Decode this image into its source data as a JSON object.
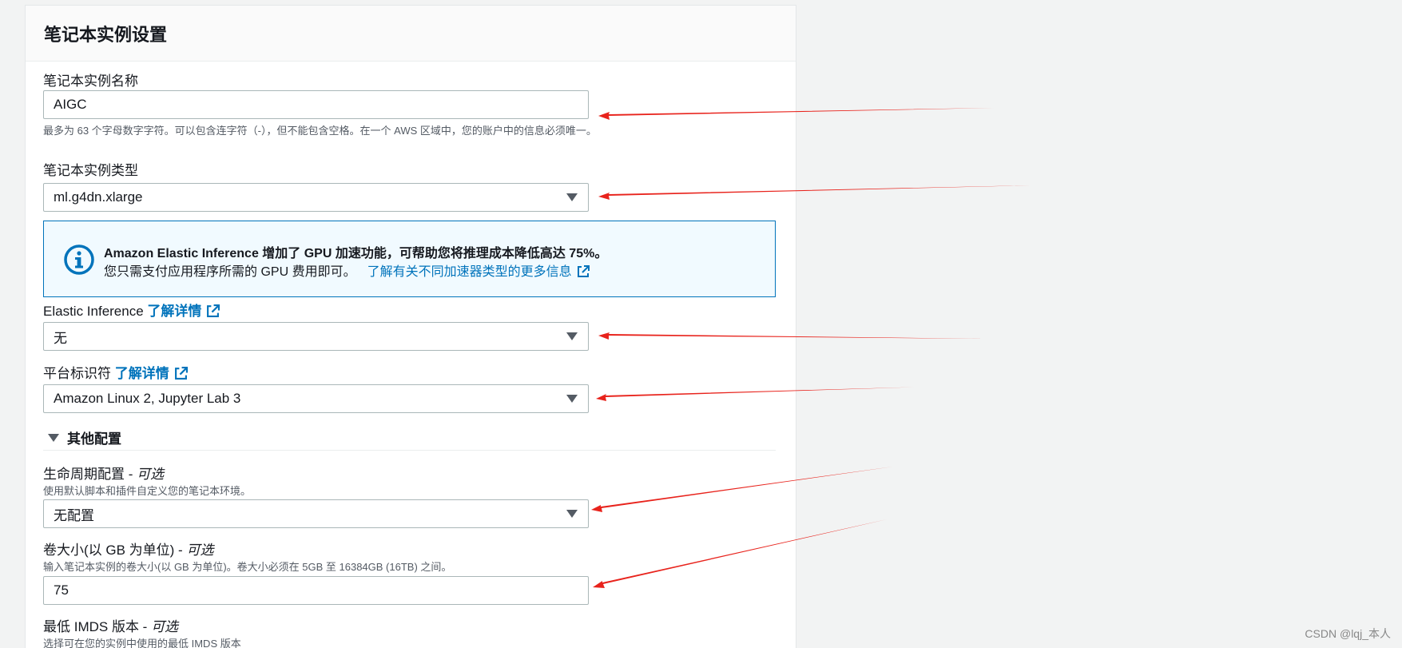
{
  "panel": {
    "title": "笔记本实例设置"
  },
  "notebook_name": {
    "label": "笔记本实例名称",
    "value": "AIGC",
    "help": "最多为 63 个字母数字字符。可以包含连字符（-），但不能包含空格。在一个 AWS 区域中，您的账户中的信息必须唯一。"
  },
  "instance_type": {
    "label": "笔记本实例类型",
    "value": "ml.g4dn.xlarge"
  },
  "alert": {
    "title": "Amazon Elastic Inference 增加了 GPU 加速功能，可帮助您将推理成本降低高达 75%。",
    "body": "您只需支付应用程序所需的 GPU 费用即可。",
    "link": "了解有关不同加速器类型的更多信息"
  },
  "elastic_inference": {
    "label": "Elastic Inference",
    "link": "了解详情",
    "value": "无"
  },
  "platform": {
    "label": "平台标识符",
    "link": "了解详情",
    "value": "Amazon Linux 2, Jupyter Lab 3"
  },
  "other_config": {
    "label": "其他配置"
  },
  "lifecycle": {
    "label": "生命周期配置 - ",
    "optional": "可选",
    "help": "使用默认脚本和插件自定义您的笔记本环境。",
    "value": "无配置"
  },
  "volume": {
    "label": "卷大小(以 GB 为单位) - ",
    "optional": "可选",
    "help": "输入笔记本实例的卷大小(以 GB 为单位)。卷大小必须在 5GB 至 16384GB (16TB) 之间。",
    "value": "75"
  },
  "imds": {
    "label": "最低 IMDS 版本 - ",
    "optional": "可选",
    "help": "选择可在您的实例中使用的最低 IMDS 版本"
  },
  "watermark": "CSDN @lqj_本人",
  "colors": {
    "accent": "#0073bb",
    "annotation_arrow": "#e8231c"
  }
}
